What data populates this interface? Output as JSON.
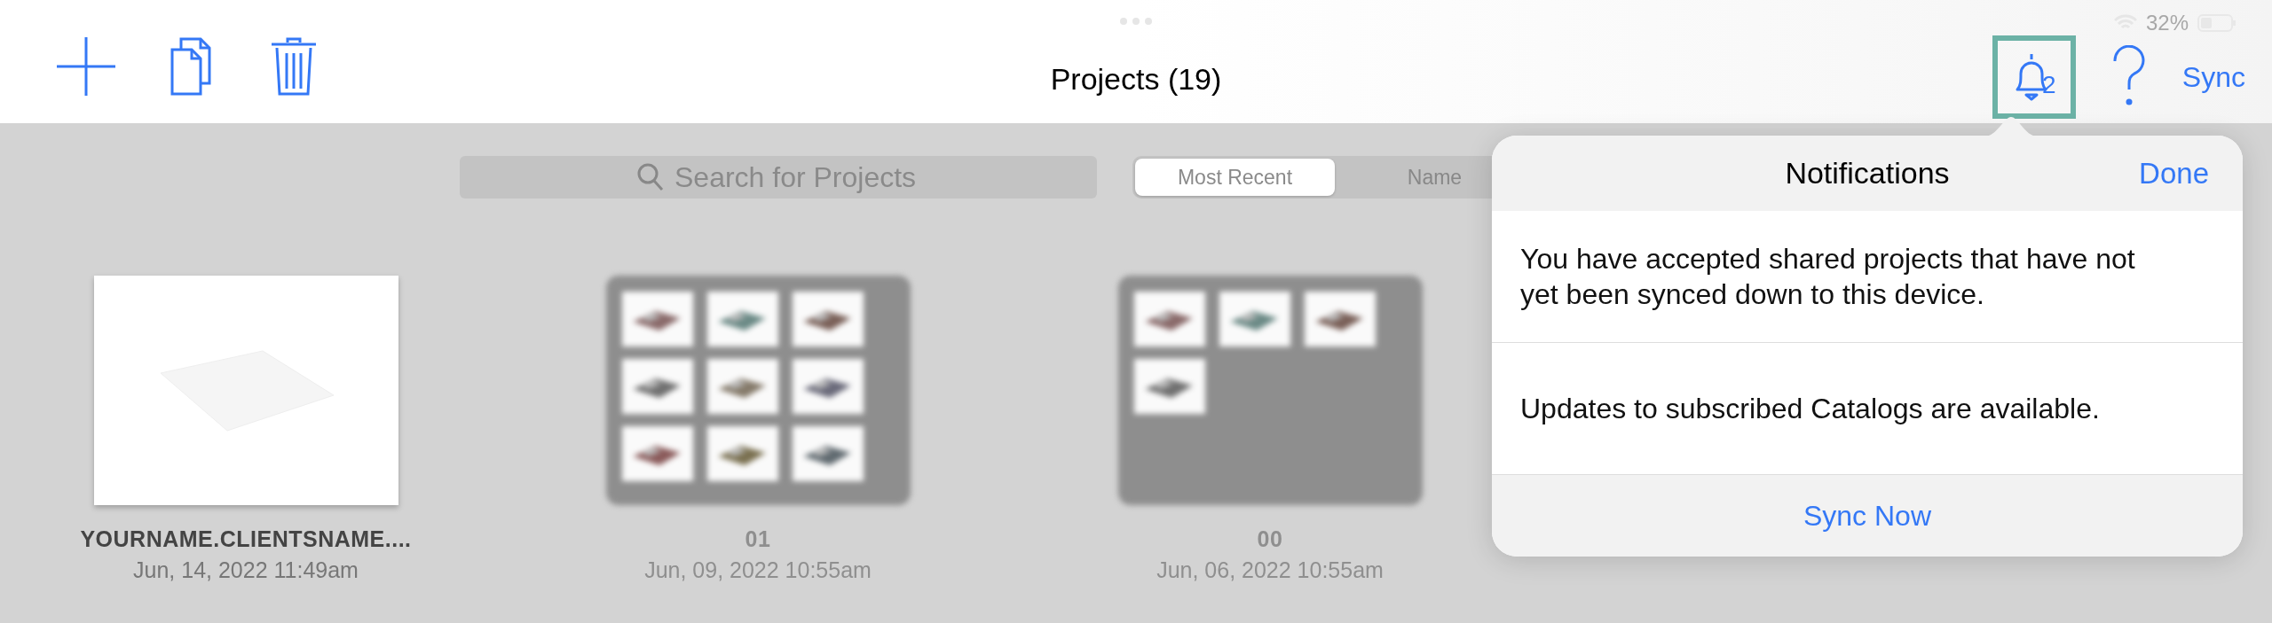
{
  "status_bar": {
    "battery": "32%"
  },
  "toolbar": {
    "title": "Projects (19)",
    "notifications": {
      "badge": "2",
      "highlighted": true
    },
    "sync": "Sync"
  },
  "search": {
    "placeholder": "Search for Projects"
  },
  "sort_tabs": [
    {
      "label": "Most Recent",
      "selected": true
    },
    {
      "label": "Name",
      "selected": false
    }
  ],
  "projects": [
    {
      "name": "YOURNAME.CLIENTSNAME....",
      "date": "Jun, 14, 2022 11:49am",
      "kind": "blank",
      "blurred": false
    },
    {
      "name": "01",
      "date": "Jun, 09, 2022 10:55am",
      "kind": "grid",
      "blurred": true
    },
    {
      "name": "00",
      "date": "Jun, 06, 2022 10:55am",
      "kind": "grid",
      "blurred": true
    }
  ],
  "popover": {
    "title": "Notifications",
    "done": "Done",
    "messages": [
      "You have accepted shared projects that have not yet been synced down to this device.",
      "Updates to subscribed Catalogs are available."
    ],
    "action": "Sync Now"
  }
}
